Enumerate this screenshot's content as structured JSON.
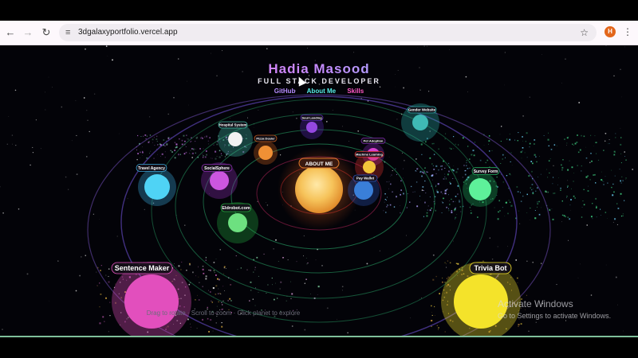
{
  "browser": {
    "url": "3dgalaxyportfolio.vercel.app",
    "profile_initial": "H",
    "icons": {
      "back": "arrow-left-icon",
      "forward": "arrow-right-icon",
      "reload": "reload-icon",
      "site": "site-info-icon",
      "bookmark": "star-icon",
      "menu": "kebab-menu-icon"
    }
  },
  "page": {
    "title": "Hadia Masood",
    "subtitle": "FULL STACK DEVELOPER",
    "nav": [
      {
        "label": "GitHub",
        "color": "#b68cff"
      },
      {
        "label": "About Me",
        "color": "#58f0ea"
      },
      {
        "label": "Skills",
        "color": "#ff58c6"
      }
    ],
    "hint": "Drag to rotate · Scroll to zoom · Click planet to explore",
    "sun_label": "ABOUT ME"
  },
  "planets": [
    {
      "name": "Sentence Maker",
      "color": "#e24fbd",
      "glow": "#e24fbd"
    },
    {
      "name": "Trivia Bot",
      "color": "#f4e32a",
      "glow": "#f4e32a"
    },
    {
      "name": "Travel Agency",
      "color": "#4fd3f5",
      "glow": "#3aa6d8"
    },
    {
      "name": "SocialSphere",
      "color": "#cc56e0",
      "glow": "#8a2fb0"
    },
    {
      "name": "Eldrobot.com",
      "color": "#6de080",
      "glow": "#22a33c"
    },
    {
      "name": "Survey Form",
      "color": "#5ef19a",
      "glow": "#1fb05c"
    },
    {
      "name": "Gender Website",
      "color": "#3fb9b5",
      "glow": "#2aa8a4"
    },
    {
      "name": "Hospital System",
      "color": "#f2f2f2",
      "glow": "#3fb8a3"
    },
    {
      "name": "Pizza Dealer",
      "color": "#f09035",
      "glow": "#c05b1d"
    },
    {
      "name": "Soul Landing",
      "color": "#9448e0",
      "glow": "#5a2bb3"
    },
    {
      "name": "Pet Adoption",
      "color": "#d640d0",
      "glow": "#7f2bb0"
    },
    {
      "name": "Machine Learning",
      "color": "#f2c43a",
      "glow": "#d8302a"
    },
    {
      "name": "Pay Wallet",
      "color": "#3a7fd8",
      "glow": "#2b52b3"
    }
  ],
  "colors": {
    "accent_pink": "#ff5fd2",
    "accent_cyan": "#57f0ff",
    "sun": "#f6c35a",
    "orbit": "#2aa86a"
  },
  "watermark": {
    "line1": "Activate Windows",
    "line2": "Go to Settings to activate Windows."
  }
}
